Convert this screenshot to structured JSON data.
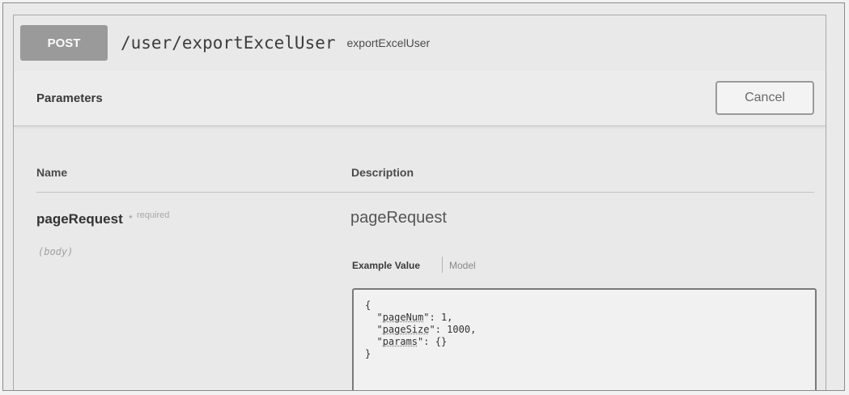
{
  "operation": {
    "method": "POST",
    "path": "/user/exportExcelUser",
    "summary": "exportExcelUser"
  },
  "parameters_section": {
    "title": "Parameters",
    "cancel_label": "Cancel"
  },
  "table": {
    "headers": {
      "name": "Name",
      "description": "Description"
    }
  },
  "parameter": {
    "name": "pageRequest",
    "required_marker": "*",
    "required_label": "required",
    "location": "(body)",
    "description": "pageRequest",
    "example_tab_label": "Example Value",
    "model_tab_label": "Model",
    "example": {
      "open": "{",
      "lines": [
        {
          "key": "pageNum",
          "value": "1,"
        },
        {
          "key": "pageSize",
          "value": "1000,"
        },
        {
          "key": "params",
          "value": "{}"
        }
      ],
      "close": "}"
    }
  },
  "colors": {
    "method_badge": "#9a9a9a",
    "background": "#eaeaea"
  }
}
